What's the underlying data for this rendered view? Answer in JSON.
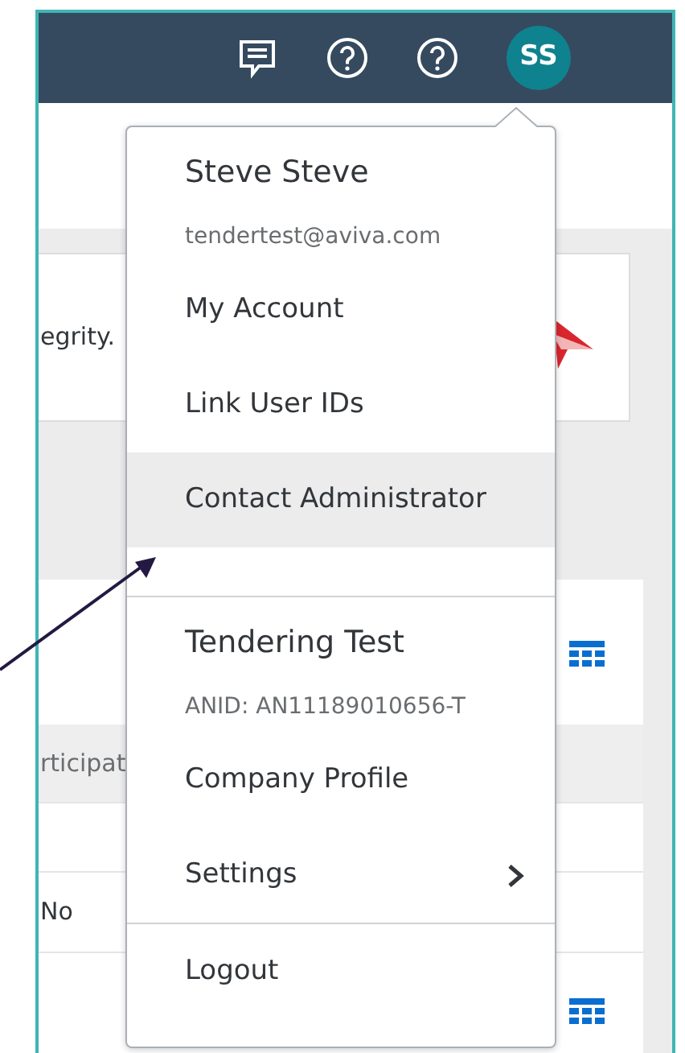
{
  "header": {
    "avatar_initials": "SS"
  },
  "page": {
    "card_text": "egrity.",
    "table_header": "rticipat",
    "table_cell": "No"
  },
  "menu": {
    "sections": [
      {
        "items": [
          {
            "kind": "name",
            "text": "Steve Steve"
          },
          {
            "kind": "detail",
            "text": "tendertest@aviva.com"
          },
          {
            "kind": "link",
            "text": "My Account",
            "selected": false
          },
          {
            "kind": "link",
            "text": "Link User IDs",
            "selected": false
          },
          {
            "kind": "link",
            "text": "Contact Administrator",
            "selected": true
          },
          {
            "kind": "spacer"
          }
        ]
      },
      {
        "items": [
          {
            "kind": "name",
            "text": "Tendering Test"
          },
          {
            "kind": "detail",
            "text": "ANID: AN11189010656-T"
          },
          {
            "kind": "link",
            "text": "Company Profile",
            "selected": false
          },
          {
            "kind": "link",
            "text": "Settings",
            "selected": false,
            "submenu": true
          }
        ]
      },
      {
        "items": [
          {
            "kind": "link",
            "text": "Logout",
            "selected": false
          }
        ]
      }
    ]
  }
}
